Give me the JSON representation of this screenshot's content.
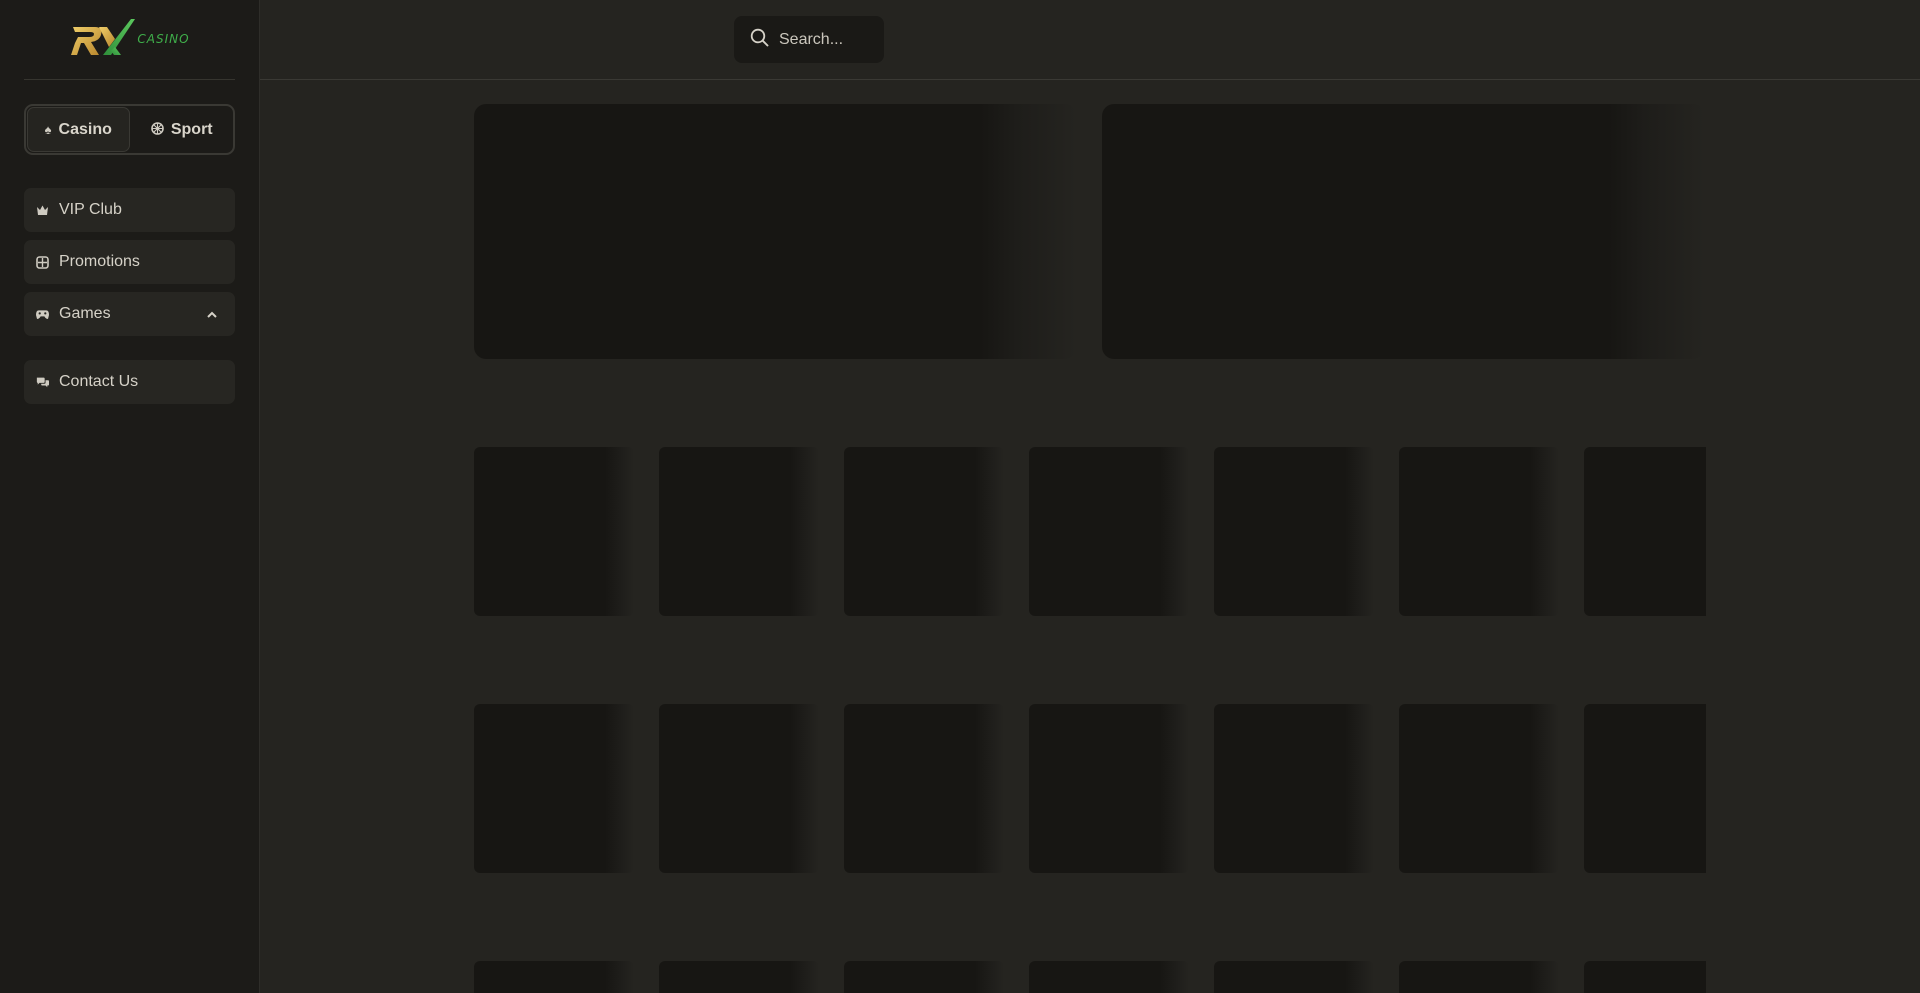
{
  "logo": {
    "mark": "RX",
    "text": "CASINO"
  },
  "mode_switch": [
    {
      "label": "Casino",
      "icon": "spade-icon",
      "active": true
    },
    {
      "label": "Sport",
      "icon": "ball-icon",
      "active": false
    }
  ],
  "nav": {
    "vip": "VIP Club",
    "promotions": "Promotions",
    "games": "Games",
    "contact": "Contact Us"
  },
  "search": {
    "placeholder": "Search..."
  },
  "colors": {
    "sidebar_bg": "#1c1b18",
    "page_bg": "#252420",
    "skeleton": "#171613",
    "logo_gold": "#d9b24a",
    "logo_green": "#3fae4a"
  }
}
